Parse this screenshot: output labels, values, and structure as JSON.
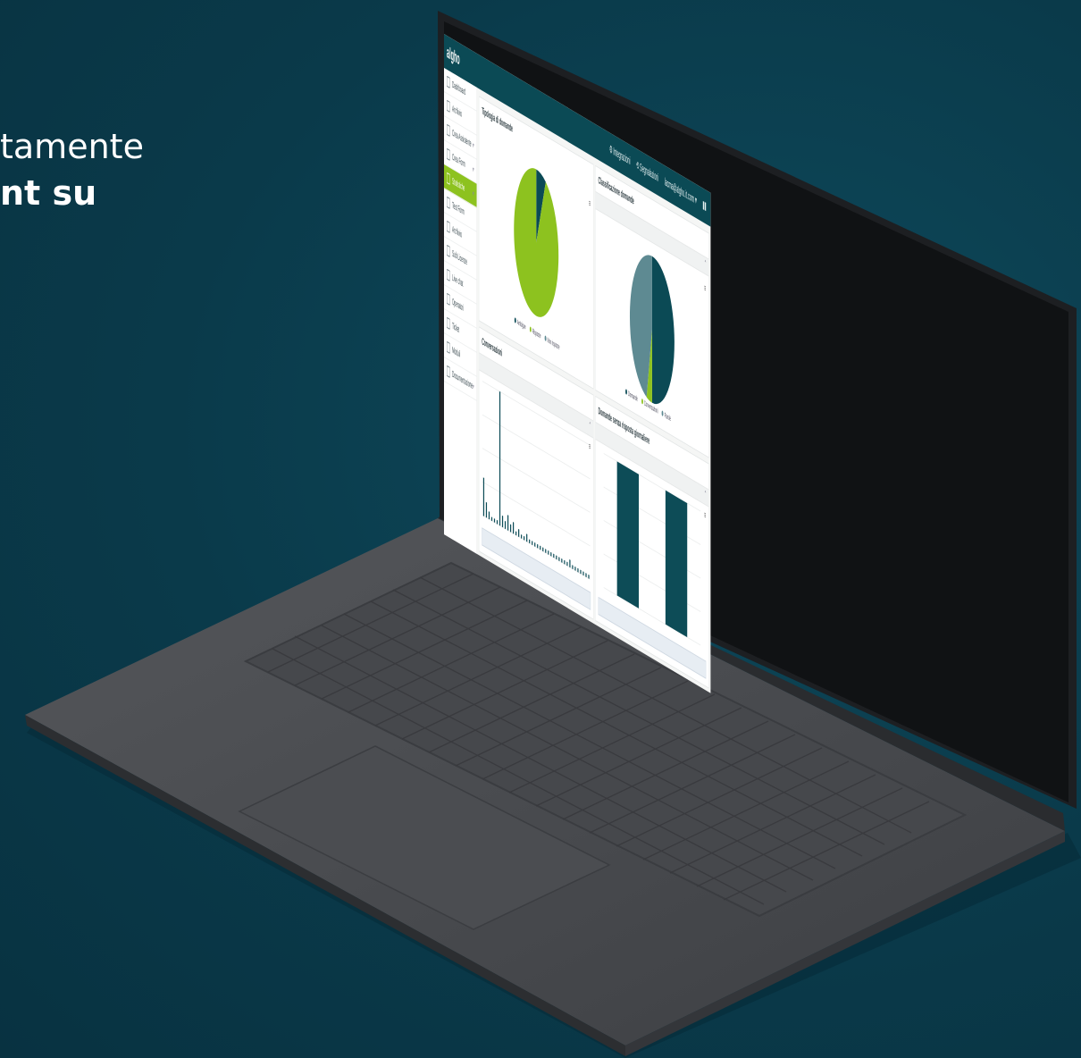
{
  "headline": {
    "line1": "tamente",
    "line2": "nt su"
  },
  "app": {
    "logo": "algho",
    "top_nav": {
      "integrations": "Integrazioni",
      "signals": "Segnalazioni",
      "user": "lacma@algho.it.com"
    }
  },
  "sidebar": {
    "items": [
      {
        "label": "Dashboard",
        "icon": "grid-icon"
      },
      {
        "label": "Archivio",
        "icon": "folder-icon"
      },
      {
        "label": "Crea Assistente",
        "icon": "user-icon",
        "caret": "▾"
      },
      {
        "label": "Crea Form",
        "icon": "form-icon",
        "caret": "▾"
      },
      {
        "label": "Statistiche",
        "icon": "check-icon",
        "caret": "▾",
        "active": true
      },
      {
        "label": "Test Form",
        "icon": "clipboard-icon"
      },
      {
        "label": "Archivio",
        "icon": "box-icon"
      },
      {
        "label": "Sub Licenze",
        "icon": "users-icon"
      },
      {
        "label": "Live chat",
        "icon": "headset-icon"
      },
      {
        "label": "Operatori",
        "icon": "operator-icon"
      },
      {
        "label": "Ticket",
        "icon": "ticket-icon"
      },
      {
        "label": "Moduli",
        "icon": "modules-icon"
      },
      {
        "label": "Documentazione",
        "icon": "book-icon",
        "caret": "▾"
      }
    ]
  },
  "panels": {
    "question_type": {
      "title": "Tipologia di domande",
      "legend": [
        "Ambigue",
        "Risposte",
        "Non risposte"
      ]
    },
    "classification": {
      "title": "Classificazione domande",
      "legend": [
        "Domande",
        "Conversazioni",
        "Parole"
      ]
    },
    "conversations": {
      "title": "Conversazioni"
    },
    "unanswered": {
      "title": "Domande senza risposta giornaliere"
    }
  },
  "colors": {
    "dark_teal": "#0b4a55",
    "green": "#8dc21f",
    "slate": "#5e8a92",
    "bar": "#0d4c57"
  },
  "chart_data": [
    {
      "type": "pie",
      "title": "Tipologia di domande",
      "slices": [
        {
          "name": "Ambigue",
          "value": 7
        },
        {
          "name": "Risposte",
          "value": 93
        },
        {
          "name": "Non risposte",
          "value": 0
        }
      ]
    },
    {
      "type": "pie",
      "title": "Classificazione domande",
      "slices": [
        {
          "name": "Domande",
          "value": 50
        },
        {
          "name": "Conversazioni",
          "value": 4
        },
        {
          "name": "Parole",
          "value": 46
        }
      ]
    },
    {
      "type": "bar",
      "title": "Conversazioni",
      "values": [
        10,
        4,
        2,
        1,
        1,
        1,
        35,
        3,
        2,
        4,
        2,
        3,
        1,
        2,
        1,
        1,
        2,
        1,
        1,
        1,
        1,
        1,
        1,
        1,
        1,
        1,
        1,
        1,
        1,
        1,
        1,
        1,
        2,
        1,
        1,
        1,
        1,
        1,
        1,
        1
      ]
    },
    {
      "type": "bar",
      "title": "Domande senza risposta giornaliere",
      "values": [
        1,
        1
      ]
    }
  ]
}
